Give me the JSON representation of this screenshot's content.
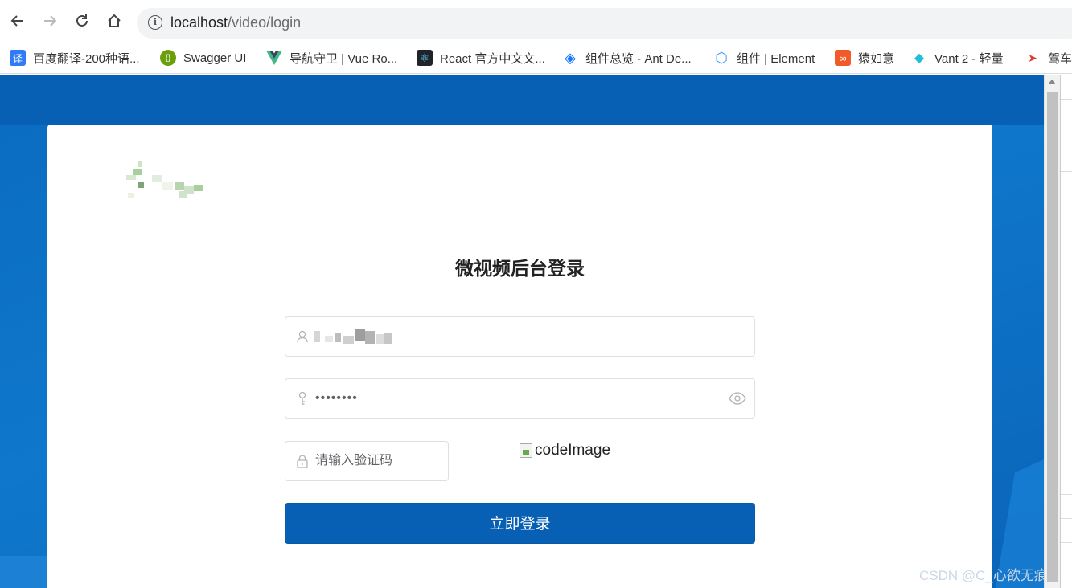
{
  "browser": {
    "url_host": "localhost",
    "url_path": "/video/login",
    "bookmarks": [
      {
        "label": "百度翻译-200种语...",
        "icon": "translate-icon",
        "icon_text": "译",
        "color": "#2f7cf6"
      },
      {
        "label": "Swagger UI",
        "icon": "swagger-icon",
        "icon_text": "{}",
        "color": "#6a9f0b"
      },
      {
        "label": "导航守卫 | Vue Ro...",
        "icon": "vue-icon",
        "icon_text": "",
        "color": "#41b883"
      },
      {
        "label": "React 官方中文文...",
        "icon": "react-icon",
        "icon_text": "⚛",
        "color": "#20232a"
      },
      {
        "label": "组件总览 - Ant De...",
        "icon": "ant-design-icon",
        "icon_text": "◈",
        "color": "#ffffff"
      },
      {
        "label": "组件 | Element",
        "icon": "element-icon",
        "icon_text": "⬡",
        "color": "#409eff"
      },
      {
        "label": "猿如意",
        "icon": "yuanruyi-icon",
        "icon_text": "∞",
        "color": "#f15b2a"
      },
      {
        "label": "Vant 2 - 轻量",
        "icon": "vant-icon",
        "icon_text": "◆",
        "color": "#1fbfd6"
      },
      {
        "label": "驾车",
        "icon": "compass-icon",
        "icon_text": "➤",
        "color": "#ffffff"
      }
    ]
  },
  "login": {
    "title": "微视频后台登录",
    "password_mask": "••••••••",
    "code_placeholder": "请输入验证码",
    "code_image_alt": "codeImage",
    "submit_label": "立即登录"
  },
  "watermark": "CSDN @C_心欲无痕",
  "colors": {
    "primary": "#0760b4",
    "background": "#0a6bbf",
    "border": "#dcdfe6"
  }
}
